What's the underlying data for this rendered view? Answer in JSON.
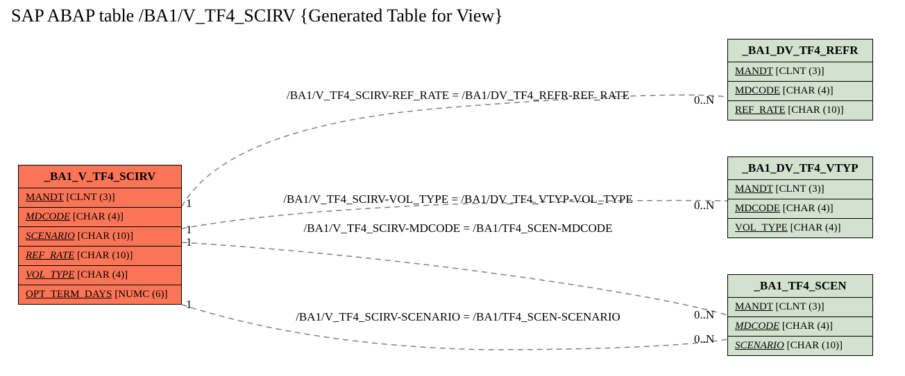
{
  "title": "SAP ABAP table /BA1/V_TF4_SCIRV {Generated Table for View}",
  "entities": {
    "main": {
      "name": "_BA1_V_TF4_SCIRV",
      "fields": [
        {
          "name": "MANDT",
          "type": "[CLNT (3)]",
          "underline": true,
          "italic": false
        },
        {
          "name": "MDCODE",
          "type": "[CHAR (4)]",
          "underline": true,
          "italic": true
        },
        {
          "name": "SCENARIO",
          "type": "[CHAR (10)]",
          "underline": true,
          "italic": true
        },
        {
          "name": "REF_RATE",
          "type": "[CHAR (10)]",
          "underline": true,
          "italic": true
        },
        {
          "name": "VOL_TYPE",
          "type": "[CHAR (4)]",
          "underline": true,
          "italic": true
        },
        {
          "name": "OPT_TERM_DAYS",
          "type": "[NUMC (6)]",
          "underline": true,
          "italic": false
        }
      ]
    },
    "refr": {
      "name": "_BA1_DV_TF4_REFR",
      "fields": [
        {
          "name": "MANDT",
          "type": "[CLNT (3)]",
          "underline": true,
          "italic": false
        },
        {
          "name": "MDCODE",
          "type": "[CHAR (4)]",
          "underline": true,
          "italic": false
        },
        {
          "name": "REF_RATE",
          "type": "[CHAR (10)]",
          "underline": true,
          "italic": false
        }
      ]
    },
    "vtyp": {
      "name": "_BA1_DV_TF4_VTYP",
      "fields": [
        {
          "name": "MANDT",
          "type": "[CLNT (3)]",
          "underline": true,
          "italic": false
        },
        {
          "name": "MDCODE",
          "type": "[CHAR (4)]",
          "underline": true,
          "italic": false
        },
        {
          "name": "VOL_TYPE",
          "type": "[CHAR (4)]",
          "underline": true,
          "italic": false
        }
      ]
    },
    "scen": {
      "name": "_BA1_TF4_SCEN",
      "fields": [
        {
          "name": "MANDT",
          "type": "[CLNT (3)]",
          "underline": true,
          "italic": false
        },
        {
          "name": "MDCODE",
          "type": "[CHAR (4)]",
          "underline": true,
          "italic": true
        },
        {
          "name": "SCENARIO",
          "type": "[CHAR (10)]",
          "underline": true,
          "italic": true
        }
      ]
    }
  },
  "relations": {
    "r1": {
      "label": "/BA1/V_TF4_SCIRV-REF_RATE = /BA1/DV_TF4_REFR-REF_RATE",
      "left": "1",
      "right": "0..N"
    },
    "r2": {
      "label": "/BA1/V_TF4_SCIRV-VOL_TYPE = /BA1/DV_TF4_VTYP-VOL_TYPE",
      "left": "1",
      "right": "0..N"
    },
    "r3": {
      "label": "/BA1/V_TF4_SCIRV-MDCODE = /BA1/TF4_SCEN-MDCODE",
      "left": "1",
      "right": "0..N"
    },
    "r4": {
      "label": "/BA1/V_TF4_SCIRV-SCENARIO = /BA1/TF4_SCEN-SCENARIO",
      "left": "1",
      "right": "0..N"
    }
  }
}
